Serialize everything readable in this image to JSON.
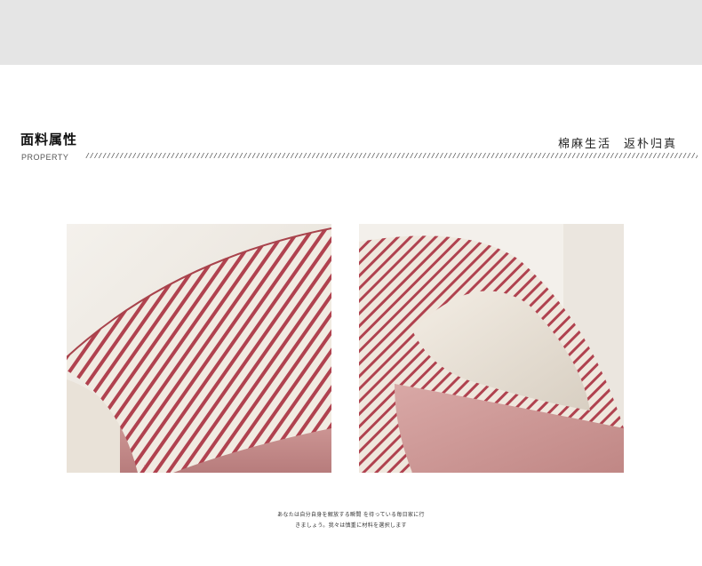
{
  "header": {
    "title_cn": "面料属性",
    "title_en": "PROPERTY",
    "slogan_part1": "棉麻生活",
    "slogan_part2": "返朴归真"
  },
  "photos": [
    {
      "icon": "striped-fabric-slipper-closeup-image"
    },
    {
      "icon": "slipper-toe-lining-closeup-image"
    }
  ],
  "caption": {
    "line1": "あなたは自分自身を解放する瞬間 を待っている毎日家に行",
    "line2": "きましょう。我々は慎重に材料を選択します"
  },
  "colors": {
    "top_band": "#e5e5e5",
    "stripe_red": "#b0424f",
    "cream": "#efe9e0",
    "pink_fabric": "#c98f8e"
  }
}
